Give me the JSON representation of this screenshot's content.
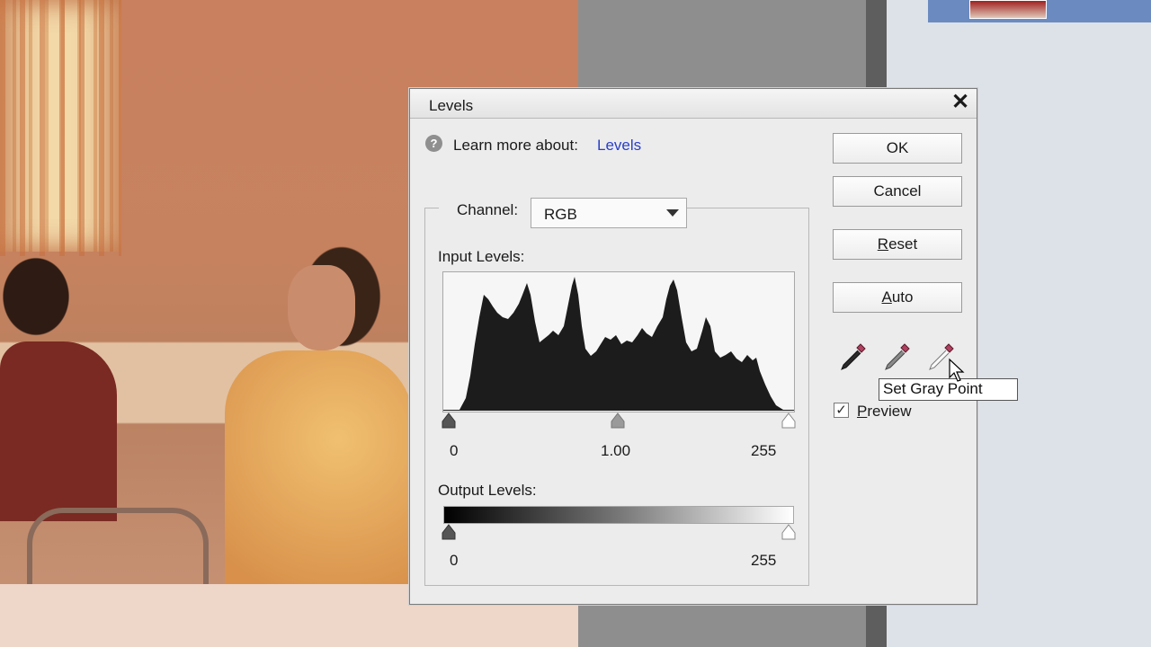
{
  "dialog": {
    "title": "Levels",
    "learn_text": "Learn more about:",
    "learn_link": "Levels",
    "channel_label": "Channel:",
    "channel_value": "RGB",
    "input_label": "Input Levels:",
    "input_values": {
      "black": "0",
      "gray": "1.00",
      "white": "255"
    },
    "output_label": "Output Levels:",
    "output_values": {
      "black": "0",
      "white": "255"
    },
    "buttons": {
      "ok": "OK",
      "cancel": "Cancel",
      "reset_u": "R",
      "reset_rest": "eset",
      "auto_u": "A",
      "auto_rest": "uto"
    },
    "preview": {
      "u": "P",
      "rest": "review",
      "checked": true
    },
    "tooltip": "Set Gray Point"
  },
  "icons": [
    "help-icon",
    "close-icon",
    "black-eyedropper-icon",
    "gray-eyedropper-icon",
    "white-eyedropper-icon",
    "dropdown-arrow-icon",
    "mouse-cursor-icon"
  ],
  "colors": {
    "link": "#2a3fc8",
    "histogram": "#1c1c1c",
    "dialog_bg": "#ececec"
  }
}
